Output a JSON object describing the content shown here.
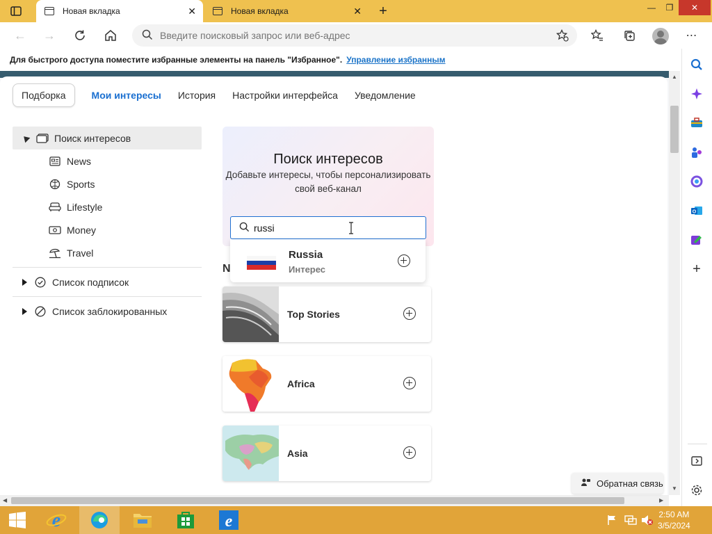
{
  "browser": {
    "tabs": [
      {
        "label": "Новая вкладка",
        "active": true
      },
      {
        "label": "Новая вкладка",
        "active": false
      }
    ],
    "address_placeholder": "Введите поисковый запрос или веб-адрес"
  },
  "favbar": {
    "text": "Для быстрого доступа поместите избранные элементы на панель \"Избранное\".",
    "link": "Управление избранным"
  },
  "settings": {
    "tabs": [
      "Подборка",
      "Мои интересы",
      "История",
      "Настройки интерфейса",
      "Уведомление"
    ],
    "active_tab": "Мои интересы",
    "tree": {
      "discover": "Поиск интересов",
      "children": [
        "News",
        "Sports",
        "Lifestyle",
        "Money",
        "Travel"
      ],
      "followed": "Список подписок",
      "blocked": "Список заблокированных"
    }
  },
  "discover": {
    "title": "Поиск интересов",
    "subtitle": "Добавьте интересы, чтобы персонализировать свой веб-канал",
    "search_value": "russi",
    "suggestion": {
      "title": "Russia",
      "subtitle": "Интерес"
    },
    "section_label_visible": "N",
    "cards": [
      "Top Stories",
      "Africa",
      "Asia"
    ]
  },
  "feedback": "Обратная связь",
  "clock": {
    "time": "2:50 AM",
    "date": "3/5/2024"
  },
  "colors": {
    "accent": "#1a6fd0",
    "titlebar": "#efc14f",
    "taskbar": "#e1a439"
  }
}
